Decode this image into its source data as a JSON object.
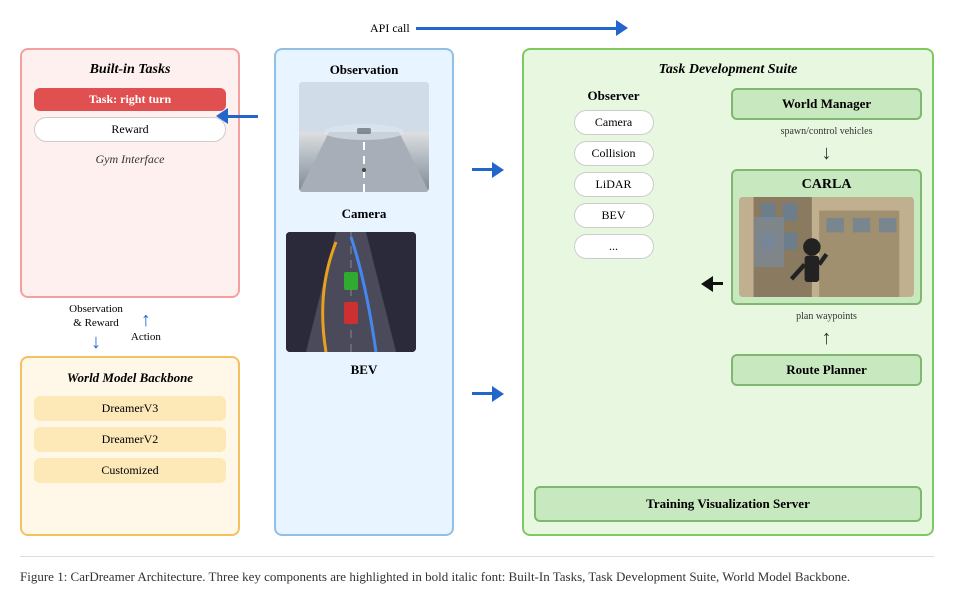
{
  "diagram": {
    "title": "Figure 1: CarDreamer Architecture. Three key components are highlighted in bold italic font: Built-In Tasks, Task Development Suite, World Model Backbone.",
    "api_call_label": "API call",
    "built_in_tasks": {
      "title": "Built-in Tasks",
      "task_label": "Task: right turn",
      "reward_label": "Reward",
      "gym_interface_label": "Gym Interface",
      "obs_reward_label": "Observation\n& Reward",
      "action_label": "Action"
    },
    "world_model": {
      "title": "World Model Backbone",
      "items": [
        "DreamerV3",
        "DreamerV2",
        "Customized"
      ]
    },
    "center_panel": {
      "observation_label": "Observation",
      "camera_label": "Camera",
      "bev_label": "BEV"
    },
    "task_dev_suite": {
      "title": "Task Development Suite",
      "observer_title": "Observer",
      "observer_items": [
        "Camera",
        "Collision",
        "LiDAR",
        "BEV",
        "..."
      ],
      "world_manager_label": "World Manager",
      "spawn_label": "spawn/control vehicles",
      "carla_label": "CARLA",
      "plan_label": "plan waypoints",
      "route_planner_label": "Route Planner",
      "training_viz_label": "Training Visualization Server"
    }
  }
}
